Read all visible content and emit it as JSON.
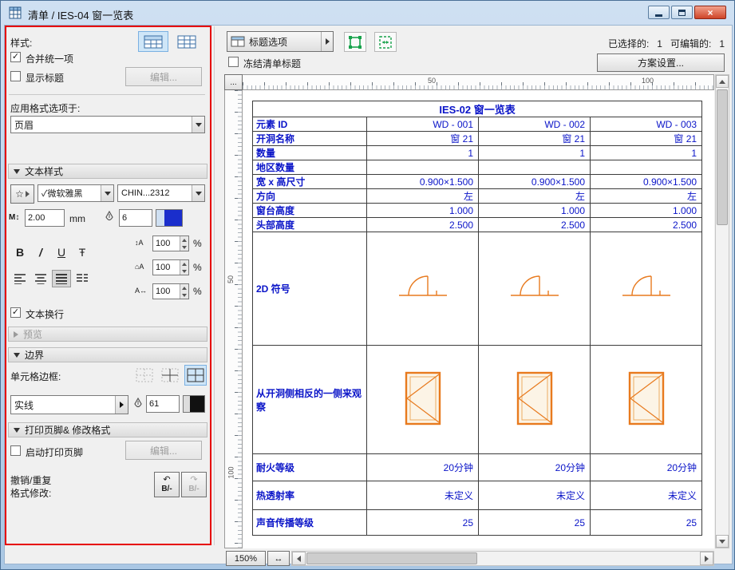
{
  "colors": {
    "table-text": "#0a14c8",
    "symbol-orange": "#e87a1e",
    "annotation-red": "#e60000",
    "tool-green": "#17a24b",
    "select-blue": "#cfe6f8"
  },
  "window": {
    "title": "清单 / IES-04 窗一览表"
  },
  "icons": {
    "app_icon": "grid-table",
    "close": "×",
    "checkmark": "✓",
    "star": "☆",
    "m_size": "M↕",
    "line_spacing_icon": "↕A",
    "para_spacing_icon": "⌂A",
    "tracking_icon": "A↔",
    "fit_width": "↔",
    "undo_arrow": "↶",
    "redo_arrow": "↷"
  },
  "sidebar": {
    "style_label": "样式:",
    "merge_uniform_label": "合并统一项",
    "show_title_label": "显示标题",
    "edit_label": "编辑...",
    "apply_format_label": "应用格式选项于:",
    "apply_format_value": "页眉",
    "text_style_header": "文本样式",
    "font_value": "✓微软雅黑",
    "encoding_value": "CHIN...2312",
    "size_value": "2.00",
    "size_unit": "mm",
    "pen_value": "6",
    "bold_label": "B",
    "italic_label": "/",
    "underline_label": "U",
    "strike_label": "Ŧ",
    "line_spacing_value": "100",
    "para_spacing_value": "100",
    "tracking_value": "100",
    "percent": "%",
    "wrap_label": "文本换行",
    "preview_header": "预览",
    "border_header": "边界",
    "cell_border_label": "单元格边框:",
    "line_type_value": "实线",
    "border_pen_value": "61",
    "footer_header": "打印页脚& 修改格式",
    "footer_enable_label": "启动打印页脚",
    "footer_edit_label": "编辑...",
    "undo_line1": "撤销/重复",
    "undo_line2": "格式修改:",
    "undo_sub": "B/-"
  },
  "toolbar": {
    "title_options_label": "标题选项",
    "selected_label": "已选择的:",
    "selected_value": "1",
    "editable_label": "可编辑的:",
    "editable_value": "1",
    "freeze_label": "冻结清单标题",
    "scheme_button_label": "方案设置..."
  },
  "ruler": {
    "corner": "...",
    "h_marks": [
      "50",
      "100"
    ],
    "v_marks": [
      "50",
      "100"
    ]
  },
  "table": {
    "title": "IES-02 窗一览表",
    "rows": [
      {
        "label": "元素 ID",
        "values": [
          "WD - 001",
          "WD - 002",
          "WD - 003"
        ]
      },
      {
        "label": "开洞名称",
        "values": [
          "窗 21",
          "窗 21",
          "窗 21"
        ]
      },
      {
        "label": "数量",
        "values": [
          "1",
          "1",
          "1"
        ]
      },
      {
        "label": "地区数量",
        "values": [
          "",
          "",
          ""
        ]
      },
      {
        "label": "宽 x 高尺寸",
        "values": [
          "0.900×1.500",
          "0.900×1.500",
          "0.900×1.500"
        ]
      },
      {
        "label": "方向",
        "values": [
          "左",
          "左",
          "左"
        ]
      },
      {
        "label": "窗台高度",
        "values": [
          "1.000",
          "1.000",
          "1.000"
        ]
      },
      {
        "label": "头部高度",
        "values": [
          "2.500",
          "2.500",
          "2.500"
        ]
      },
      {
        "label": "2D 符号",
        "type": "plan-symbol"
      },
      {
        "label": "从开洞侧相反的一侧来观察",
        "type": "elevation-symbol"
      },
      {
        "label": "耐火等级",
        "values": [
          "20分钟",
          "20分钟",
          "20分钟"
        ]
      },
      {
        "label": "热透射率",
        "values": [
          "未定义",
          "未定义",
          "未定义"
        ]
      },
      {
        "label": "声音传播等级",
        "values": [
          "25",
          "25",
          "25"
        ]
      }
    ]
  },
  "statusbar": {
    "zoom": "150%"
  }
}
